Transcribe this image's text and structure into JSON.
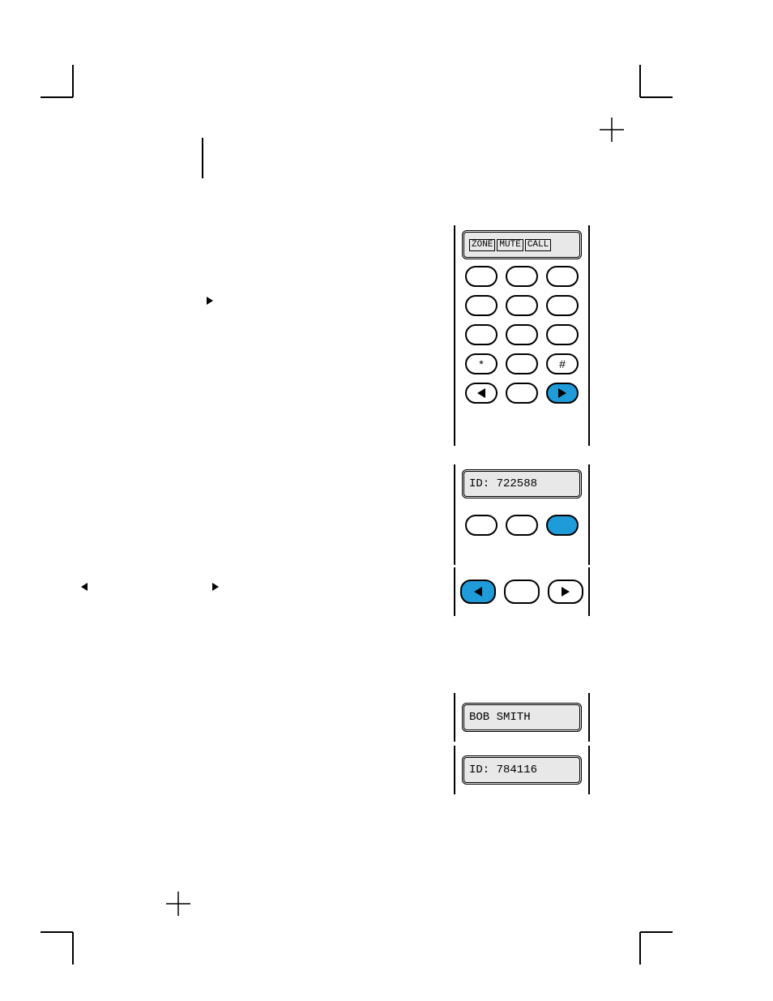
{
  "panel1": {
    "lcd_softkeys": [
      "ZONE",
      "MUTE",
      "CALL"
    ],
    "keys": {
      "star": "*",
      "hash": "#"
    }
  },
  "panel2": {
    "lcd_text": "ID: 722588"
  },
  "panel3": {
    "lcd_text": "BOB SMITH"
  },
  "panel4": {
    "lcd_text": "ID: 784116"
  }
}
